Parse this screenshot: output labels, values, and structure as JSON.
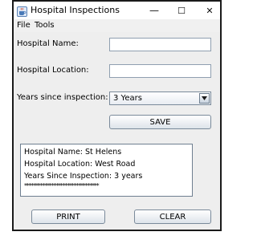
{
  "window": {
    "title": "Hospital Inspections",
    "controls": {
      "minimize": "—",
      "maximize": "☐",
      "close": "✕"
    }
  },
  "menu": {
    "items": [
      "File",
      "Tools"
    ]
  },
  "form": {
    "hospital_name_label": "Hospital Name:",
    "hospital_name_value": "",
    "hospital_location_label": "Hospital Location:",
    "hospital_location_value": "",
    "years_label": "Years since inspection:",
    "years_selected": "3 Years"
  },
  "buttons": {
    "save": "SAVE",
    "print": "PRINT",
    "clear": "CLEAR"
  },
  "output": {
    "lines": [
      "Hospital Name: St Helens",
      "Hospital Location: West Road",
      "Years Since Inspection: 3 years",
      "*********************************"
    ]
  },
  "colors": {
    "accent": "#4a7ab8",
    "client_bg": "#eeeeee",
    "menubar_bg": "#f0f0f0"
  },
  "icons": {
    "app": "java-cup-icon",
    "combo_arrow": "chevron-down-icon"
  }
}
